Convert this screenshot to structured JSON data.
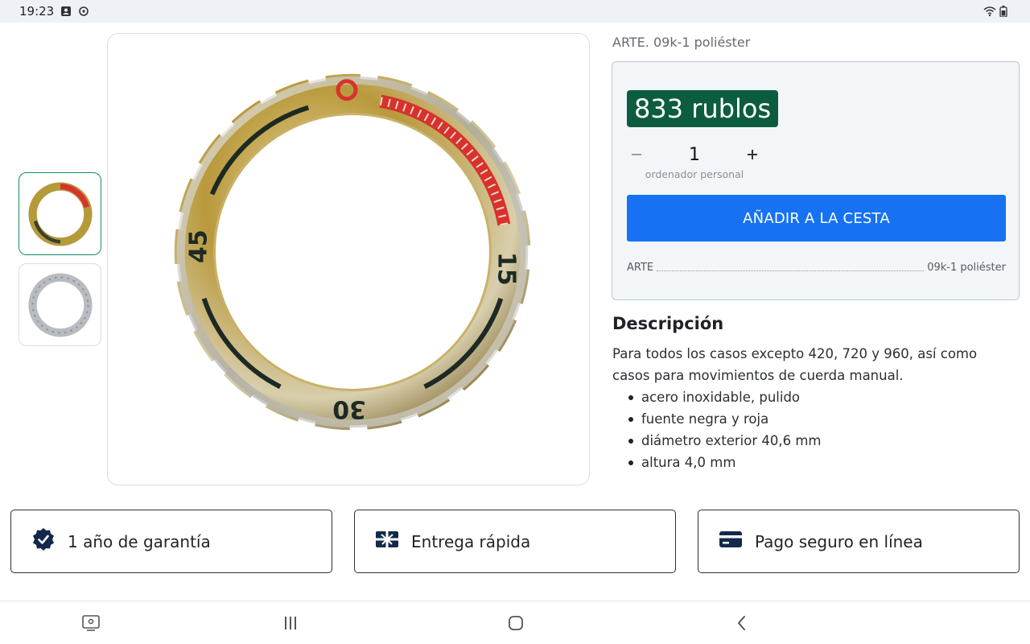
{
  "status_bar": {
    "time": "19:23",
    "icons": [
      "image-notification-icon",
      "refresh-notification-icon",
      "wifi-icon",
      "battery-icon"
    ]
  },
  "gallery": {
    "thumbnails": [
      {
        "name": "bezel-colored",
        "active": true
      },
      {
        "name": "bezel-silver",
        "active": false
      }
    ],
    "bezel_numbers": [
      "15",
      "30",
      "45"
    ]
  },
  "product": {
    "art_line": "ARTE. 09k-1 poliéster",
    "price": "833 rublos",
    "quantity": "1",
    "quantity_unit": "ordenador personal",
    "add_to_cart": "AÑADIR A LA CESTA",
    "spec": {
      "label": "ARTE",
      "value": "09k-1 poliéster"
    }
  },
  "description": {
    "title": "Descripción",
    "text": "Para todos los casos excepto 420, 720 y 960, así como casos para movimientos de cuerda manual.",
    "bullets": [
      "acero inoxidable, pulido",
      "fuente negra y roja",
      "diámetro exterior 40,6 mm",
      "altura 4,0 mm"
    ]
  },
  "features": [
    {
      "label": "1 año de garantía",
      "icon": "verified-badge-icon"
    },
    {
      "label": "Entrega rápida",
      "icon": "gift-box-icon"
    },
    {
      "label": "Pago seguro en línea",
      "icon": "credit-card-icon"
    }
  ],
  "colors": {
    "price_bg": "#0c5c3f",
    "button_bg": "#1672f3",
    "icon_navy": "#13294b"
  }
}
